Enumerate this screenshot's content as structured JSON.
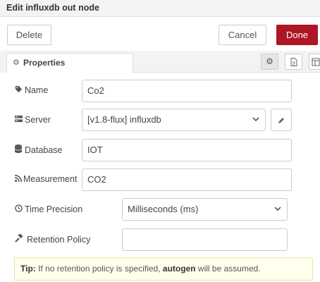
{
  "title": "Edit influxdb out node",
  "toolbar": {
    "delete_label": "Delete",
    "cancel_label": "Cancel",
    "done_label": "Done"
  },
  "tab": {
    "properties_label": "Properties"
  },
  "fields": {
    "name": {
      "label": "Name",
      "value": "Co2"
    },
    "server": {
      "label": "Server",
      "value": "[v1.8-flux] influxdb"
    },
    "database": {
      "label": "Database",
      "value": "IOT"
    },
    "measurement": {
      "label": "Measurement",
      "value": "CO2"
    },
    "time_precision": {
      "label": "Time Precision",
      "value": "Milliseconds (ms)"
    },
    "retention_policy": {
      "label": "Retention Policy",
      "value": ""
    }
  },
  "tip": {
    "prefix": "Tip:",
    "text1": "If no retention policy is specified,",
    "bold": "autogen",
    "text2": "will be assumed."
  },
  "icons": {
    "gear": "gear-icon",
    "description": "file-text-icon",
    "appearance": "layout-icon",
    "tag": "tag-icon",
    "server": "server-icon",
    "database": "database-icon",
    "measurement": "rss-icon",
    "clock": "clock-icon",
    "retention": "gavel-icon",
    "pencil": "pencil-icon"
  },
  "colors": {
    "done_bg": "#ad1625",
    "tip_bg": "#ffffee"
  }
}
